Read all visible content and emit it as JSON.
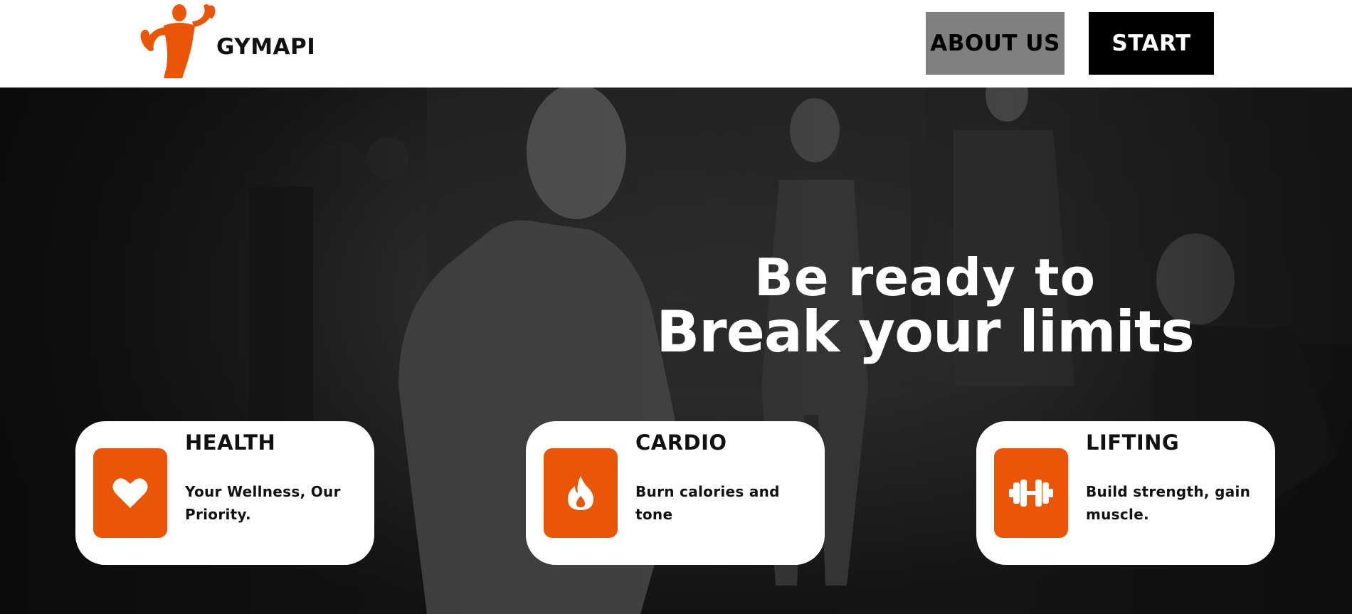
{
  "header": {
    "brand": "GYMAPI",
    "logo_icon": "flexing-athlete-icon",
    "nav": {
      "about_label": "ABOUT US",
      "start_label": "START"
    }
  },
  "hero": {
    "headline_line1": "Be ready to",
    "headline_line2": "Break your limits"
  },
  "features": [
    {
      "title": "HEALTH",
      "text": "Your Wellness, Our Priority.",
      "icon": "heart-icon"
    },
    {
      "title": "CARDIO",
      "text": "Burn calories and tone",
      "icon": "flame-icon"
    },
    {
      "title": "LIFTING",
      "text": "Build strength, gain muscle.",
      "icon": "dumbbell-icon"
    }
  ],
  "colors": {
    "accent": "#e95608",
    "header_bg": "#ffffff",
    "about_button_bg": "#808080",
    "start_button_bg": "#000000",
    "hero_bg": "#121212",
    "card_bg": "#ffffff"
  }
}
